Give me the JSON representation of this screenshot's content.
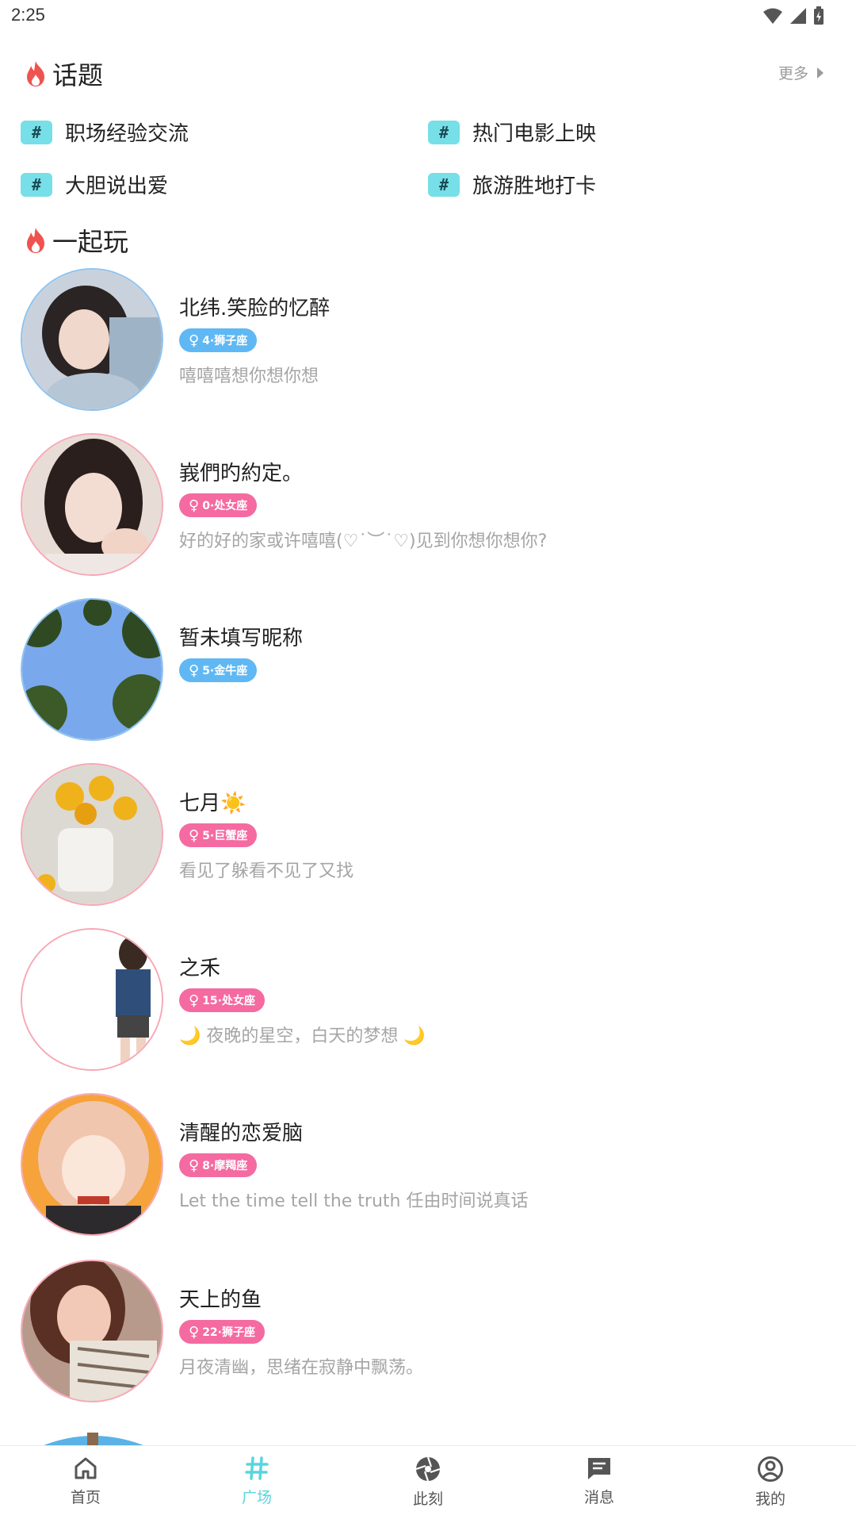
{
  "status_bar": {
    "time": "2:25"
  },
  "topics_section": {
    "title": "话题",
    "more_label": "更多",
    "topics": [
      {
        "name": "职场经验交流"
      },
      {
        "name": "热门电影上映"
      },
      {
        "name": "大胆说出爱"
      },
      {
        "name": "旅游胜地打卡"
      }
    ]
  },
  "play_section": {
    "title": "一起玩"
  },
  "users": [
    {
      "name": "北纬.笑脸的忆醉",
      "tag": "4·狮子座",
      "gender_symbol": "♀",
      "tag_color": "#5fb8f4",
      "signature": "嘻嘻嘻想你想你想"
    },
    {
      "name": "峩們旳約定。",
      "tag": "0·处女座",
      "gender_symbol": "♀",
      "tag_color": "#f46aa1",
      "signature": "好的好的家或许嘻嘻(♡˙︶˙♡)见到你想你想你?"
    },
    {
      "name": "暂未填写昵称",
      "tag": "5·金牛座",
      "gender_symbol": "♀",
      "tag_color": "#5fb8f4",
      "signature": ""
    },
    {
      "name": "七月☀️",
      "tag": "5·巨蟹座",
      "gender_symbol": "♀",
      "tag_color": "#f46aa1",
      "signature": "看见了躲看不见了又找"
    },
    {
      "name": "之禾",
      "tag": "15·处女座",
      "gender_symbol": "♀",
      "tag_color": "#f46aa1",
      "signature": "🌙 夜晚的星空，白天的梦想 🌙"
    },
    {
      "name": "清醒的恋爱脑",
      "tag": "8·摩羯座",
      "gender_symbol": "♀",
      "tag_color": "#f46aa1",
      "signature": "Let the time tell the truth 任由时间说真话"
    },
    {
      "name": "天上的鱼",
      "tag": "22·狮子座",
      "gender_symbol": "♀",
      "tag_color": "#f46aa1",
      "signature": "月夜清幽，思绪在寂静中飘荡。"
    }
  ],
  "bottom_nav": {
    "items": [
      {
        "label": "首页",
        "icon": "home-icon"
      },
      {
        "label": "广场",
        "icon": "hash-icon",
        "active": true
      },
      {
        "label": "此刻",
        "icon": "aperture-icon"
      },
      {
        "label": "消息",
        "icon": "message-icon"
      },
      {
        "label": "我的",
        "icon": "profile-icon"
      }
    ]
  },
  "colors": {
    "accent": "#56d6df",
    "flame": "#ef5350",
    "tag_pink": "#f46aa1",
    "tag_blue": "#5fb8f4"
  }
}
